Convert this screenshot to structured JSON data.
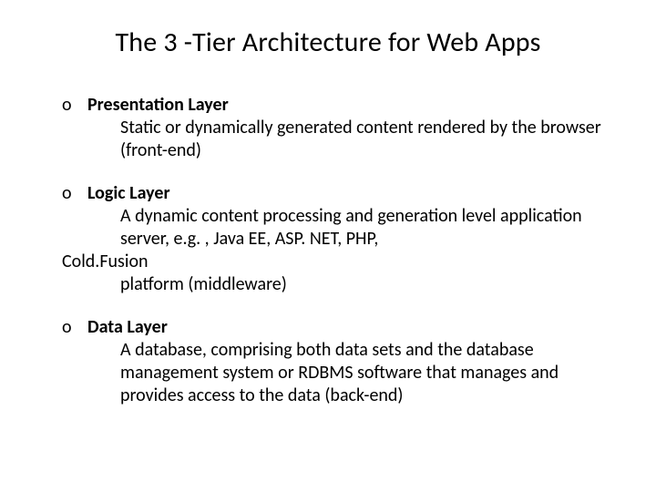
{
  "title": "The 3 -Tier Architecture for Web Apps",
  "bullet": "o",
  "items": [
    {
      "title": "Presentation Layer",
      "body1": "Static or dynamically generated content rendered by the browser (front-end)"
    },
    {
      "title": "Logic Layer",
      "body1": "A dynamic content processing and generation level application server, e.g. , Java EE, ASP. NET, PHP,",
      "body_extra": "Cold.Fusion",
      "body2": "platform (middleware)"
    },
    {
      "title": "Data Layer",
      "body1": "A database, comprising both data sets and the database management system or RDBMS software that manages and provides access to the data (back-end)"
    }
  ]
}
